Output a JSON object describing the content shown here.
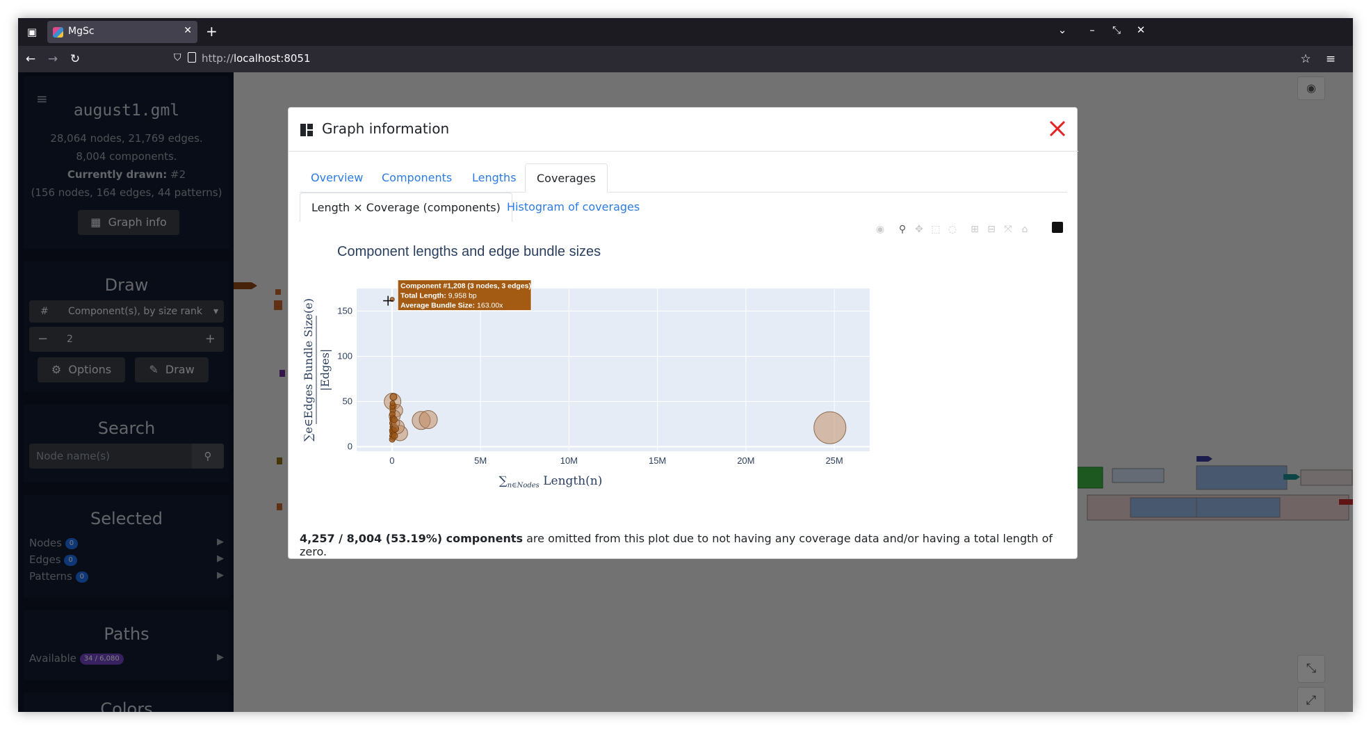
{
  "browser": {
    "tab_title": "MgSc",
    "url_prefix": "http://",
    "url_host": "localhost:8051"
  },
  "sidebar": {
    "file_name": "august1.gml",
    "stats_line1": "28,064 nodes, 21,769 edges.",
    "stats_line2": "8,004 components.",
    "currently_label": "Currently drawn:",
    "currently_value": "#2",
    "drawn_detail": "(156 nodes, 164 edges, 44 patterns)",
    "graph_info_button": "Graph info",
    "draw_title": "Draw",
    "draw_mode_hash": "#",
    "draw_mode": "Component(s), by size rank",
    "draw_value": "2",
    "options_button": "Options",
    "draw_button": "Draw",
    "search_title": "Search",
    "search_placeholder": "Node name(s)",
    "selected_title": "Selected",
    "selected_items": [
      {
        "label": "Nodes",
        "count": "0"
      },
      {
        "label": "Edges",
        "count": "0"
      },
      {
        "label": "Patterns",
        "count": "0"
      }
    ],
    "paths_title": "Paths",
    "paths_label": "Available",
    "paths_count": "34 / 6,080",
    "colors_title": "Colors"
  },
  "modal": {
    "title": "Graph information",
    "tabs": [
      "Overview",
      "Components",
      "Lengths",
      "Coverages"
    ],
    "active_tab": "Coverages",
    "subtabs": [
      "Length × Coverage (components)",
      "Histogram of coverages"
    ],
    "footer_bold": "4,257 / 8,004 (53.19%) components",
    "footer_rest": " are omitted from this plot due to not having any coverage data and/or having a total length of zero."
  },
  "colors": {
    "accent": "#2c7be5",
    "marker": "#c0865a",
    "marker_dark": "#9c5a1c",
    "tooltip_bg": "#a35a12",
    "close_red": "#e02424",
    "plot_bg": "#e5ecf6"
  },
  "chart_data": {
    "type": "scatter",
    "title": "Component lengths and edge bundle sizes",
    "xlabel": "∑_{n∈Nodes} Length(n)",
    "ylabel": "∑_{e∈Edges} Bundle Size(e) / |Edges|",
    "xlim": [
      -2000000,
      27000000
    ],
    "ylim": [
      -5,
      175
    ],
    "x_ticks": [
      {
        "v": 0,
        "label": "0"
      },
      {
        "v": 5000000,
        "label": "5M"
      },
      {
        "v": 10000000,
        "label": "10M"
      },
      {
        "v": 15000000,
        "label": "15M"
      },
      {
        "v": 20000000,
        "label": "20M"
      },
      {
        "v": 25000000,
        "label": "25M"
      }
    ],
    "y_ticks": [
      {
        "v": 0,
        "label": "0"
      },
      {
        "v": 50,
        "label": "50"
      },
      {
        "v": 100,
        "label": "100"
      },
      {
        "v": 150,
        "label": "150"
      }
    ],
    "grid": true,
    "points": [
      {
        "x": 9958,
        "y": 163,
        "size": 6
      },
      {
        "x": 24750000,
        "y": 21,
        "size": 46
      },
      {
        "x": 1650000,
        "y": 29,
        "size": 26
      },
      {
        "x": 2050000,
        "y": 30,
        "size": 26
      },
      {
        "x": 30000,
        "y": 50,
        "size": 24
      },
      {
        "x": 250000,
        "y": 40,
        "size": 18
      },
      {
        "x": 450000,
        "y": 15,
        "size": 22
      },
      {
        "x": 300000,
        "y": 22,
        "size": 20
      },
      {
        "x": 150000,
        "y": 34,
        "size": 16
      },
      {
        "x": 80000,
        "y": 55,
        "size": 10
      },
      {
        "x": 60000,
        "y": 45,
        "size": 9
      },
      {
        "x": 40000,
        "y": 40,
        "size": 8
      },
      {
        "x": 20000,
        "y": 36,
        "size": 8
      },
      {
        "x": 50000,
        "y": 32,
        "size": 8
      },
      {
        "x": 30000,
        "y": 30,
        "size": 8
      },
      {
        "x": 70000,
        "y": 28,
        "size": 8
      },
      {
        "x": 20000,
        "y": 26,
        "size": 8
      },
      {
        "x": 90000,
        "y": 24,
        "size": 8
      },
      {
        "x": 40000,
        "y": 22,
        "size": 8
      },
      {
        "x": 60000,
        "y": 20,
        "size": 8
      },
      {
        "x": 15000,
        "y": 18,
        "size": 8
      },
      {
        "x": 110000,
        "y": 18,
        "size": 8
      },
      {
        "x": 30000,
        "y": 16,
        "size": 8
      },
      {
        "x": 80000,
        "y": 14,
        "size": 8
      },
      {
        "x": 20000,
        "y": 12,
        "size": 8
      },
      {
        "x": 50000,
        "y": 10,
        "size": 8
      },
      {
        "x": 10000,
        "y": 8,
        "size": 8
      },
      {
        "x": 140000,
        "y": 12,
        "size": 9
      },
      {
        "x": 180000,
        "y": 20,
        "size": 10
      },
      {
        "x": 220000,
        "y": 26,
        "size": 11
      },
      {
        "x": 120000,
        "y": 30,
        "size": 9
      },
      {
        "x": 10000,
        "y": 44,
        "size": 7
      },
      {
        "x": 25000,
        "y": 48,
        "size": 7
      }
    ],
    "hover": {
      "line1": "Component #1,208 (3 nodes, 3 edges)",
      "total_label": "Total Length:",
      "total_value": "9,958 bp",
      "avg_label": "Average Bundle Size:",
      "avg_value": "163.00x"
    }
  }
}
